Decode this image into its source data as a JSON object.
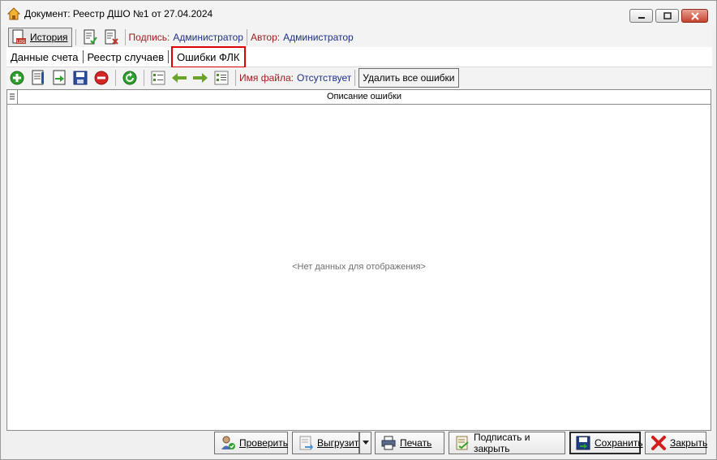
{
  "window": {
    "title": "Документ: Реестр ДШО №1 от 27.04.2024"
  },
  "toolbar1": {
    "history_label": "История",
    "signature_label": "Подпись:",
    "signature_value": "Администратор",
    "author_label": "Автор:",
    "author_value": "Администратор"
  },
  "tabs": [
    {
      "label": "Данные счета"
    },
    {
      "label": "Реестр случаев"
    },
    {
      "label": "Ошибки ФЛК",
      "active": true
    }
  ],
  "toolbar2": {
    "file_label": "Имя файла:",
    "file_value": "Отсутствует",
    "delete_all_label": "Удалить все ошибки"
  },
  "grid": {
    "column_header": "Описание ошибки",
    "empty_text": "<Нет данных для отображения>"
  },
  "bottom": {
    "check_label": "Проверить",
    "export_label": "Выгрузить",
    "print_label": "Печать",
    "sign_close_label": "Подписать и закрыть",
    "save_label": "Сохранить",
    "close_label": "Закрыть"
  },
  "colors": {
    "accent_red": "#e00000",
    "label_red": "#9b1c1c",
    "label_blue": "#1d2e8a",
    "green_icon": "#2fa12f"
  }
}
